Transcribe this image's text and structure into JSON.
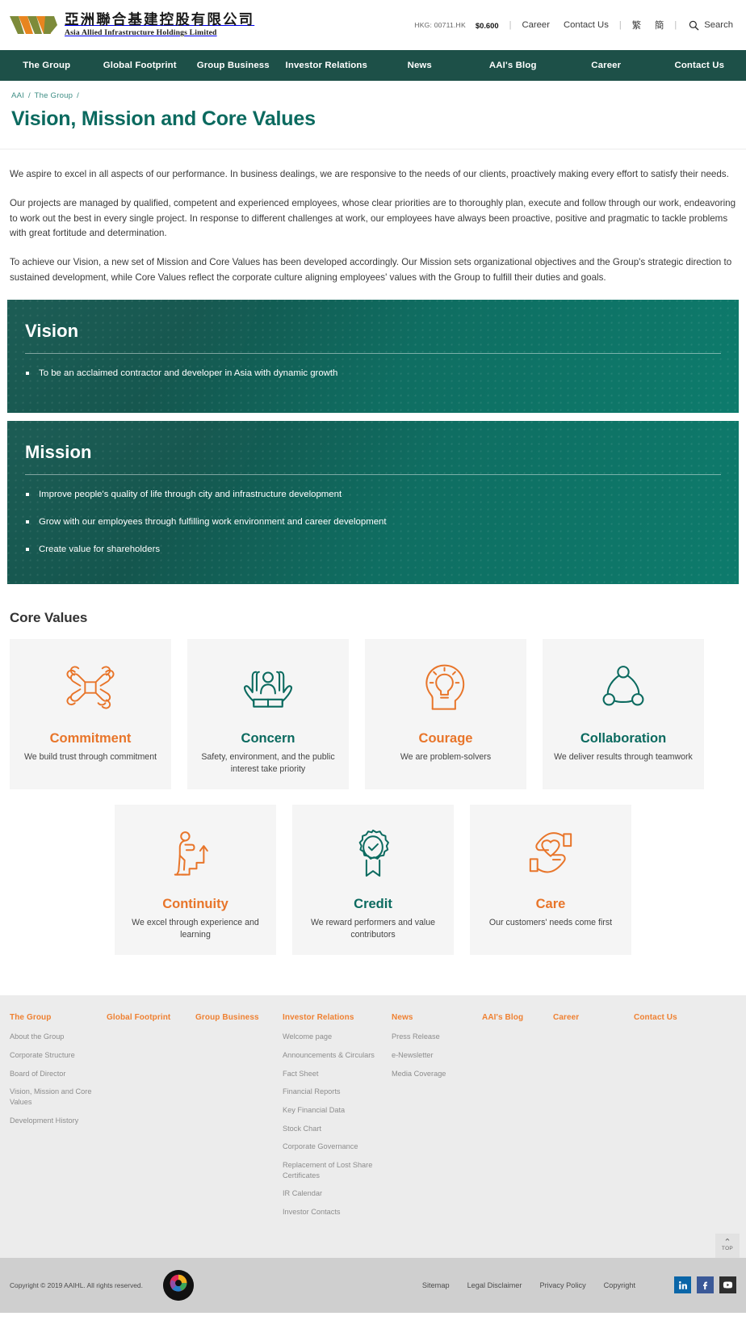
{
  "header": {
    "logo_cn": "亞洲聯合基建控股有限公司",
    "logo_en": "Asia Allied Infrastructure Holdings Limited",
    "stock_code": "HKG: 00711.HK",
    "stock_price": "$0.600",
    "career_link": "Career",
    "contact_link": "Contact Us",
    "lang_trad": "繁",
    "lang_simp": "簡",
    "search_label": "Search",
    "separator": "|"
  },
  "nav": {
    "items": [
      {
        "label": "The Group"
      },
      {
        "label": "Global Footprint"
      },
      {
        "label": "Group Business"
      },
      {
        "label": "Investor Relations"
      },
      {
        "label": "News"
      },
      {
        "label": "AAI's Blog"
      },
      {
        "label": "Career"
      },
      {
        "label": "Contact Us"
      }
    ]
  },
  "breadcrumb": {
    "items": [
      "AAI",
      "The Group"
    ],
    "sep": "/"
  },
  "page": {
    "title": "Vision, Mission and Core Values"
  },
  "intro": {
    "paragraphs": [
      "We aspire to excel in all aspects of our performance. In business dealings, we are responsive to the needs of our clients, proactively making every effort to satisfy their needs.",
      "Our projects are managed by qualified, competent and experienced employees, whose clear priorities are to thoroughly plan, execute and follow through our work, endeavoring to work out the best in every single project. In response to different challenges at work, our employees have always been proactive, positive and pragmatic to tackle problems with great fortitude and determination.",
      "To achieve our Vision, a new set of Mission and Core Values has been developed accordingly. Our Mission sets organizational objectives and the Group's strategic direction to sustained development, while Core Values reflect the corporate culture aligning employees' values with the Group to fulfill their duties and goals."
    ]
  },
  "vision": {
    "heading": "Vision",
    "items": [
      "To be an acclaimed contractor and developer in Asia with dynamic growth"
    ]
  },
  "mission": {
    "heading": "Mission",
    "items": [
      "Improve people's quality of life through city and infrastructure development",
      "Grow with our employees through fulfilling work environment and career development",
      "Create value for shareholders"
    ]
  },
  "core_values": {
    "heading": "Core Values",
    "row1": [
      {
        "title": "Commitment",
        "desc": "We build trust through commitment",
        "color": "orange",
        "icon": "handshake-square-icon"
      },
      {
        "title": "Concern",
        "desc": "Safety, environment, and the public interest take priority",
        "color": "green",
        "icon": "hands-holding-person-icon"
      },
      {
        "title": "Courage",
        "desc": "We are problem-solvers",
        "color": "orange",
        "icon": "head-lightbulb-icon"
      },
      {
        "title": "Collaboration",
        "desc": "We deliver results through teamwork",
        "color": "green",
        "icon": "network-nodes-icon"
      }
    ],
    "row2": [
      {
        "title": "Continuity",
        "desc": "We excel through experience and learning",
        "color": "orange",
        "icon": "person-climbing-stairs-icon"
      },
      {
        "title": "Credit",
        "desc": "We reward performers and value contributors",
        "color": "green",
        "icon": "award-ribbon-check-icon"
      },
      {
        "title": "Care",
        "desc": "Our customers' needs come first",
        "color": "orange",
        "icon": "hands-heart-icon"
      }
    ]
  },
  "footer": {
    "columns": [
      {
        "head": "The Group",
        "links": [
          "About the Group",
          "Corporate Structure",
          "Board of Director",
          "Vision, Mission and Core Values",
          "Development History"
        ]
      },
      {
        "head": "Global Footprint",
        "links": []
      },
      {
        "head": "Group Business",
        "links": []
      },
      {
        "head": "Investor Relations",
        "links": [
          "Welcome page",
          "Announcements & Circulars",
          "Fact Sheet",
          "Financial Reports",
          "Key Financial Data",
          "Stock Chart",
          "Corporate Governance",
          "Replacement of Lost Share Certificates",
          "IR Calendar",
          "Investor Contacts"
        ]
      },
      {
        "head": "News",
        "links": [
          "Press Release",
          "e-Newsletter",
          "Media Coverage"
        ]
      },
      {
        "head": "AAI's Blog",
        "links": []
      },
      {
        "head": "Career",
        "links": []
      },
      {
        "head": "Contact Us",
        "links": []
      }
    ],
    "top_button": {
      "label": "TOP",
      "chevron": "⌃"
    }
  },
  "bottom": {
    "copyright": "Copyright © 2019 AAIHL. All rights reserved.",
    "links": [
      "Sitemap",
      "Legal Disclaimer",
      "Privacy Policy",
      "Copyright"
    ],
    "socials": [
      "linkedin-icon",
      "facebook-icon",
      "youtube-icon"
    ]
  },
  "colors": {
    "brand_green": "#0b6a5f",
    "nav_green": "#1d5048",
    "accent_orange": "#e8752a",
    "footer_orange": "#ef8132"
  }
}
